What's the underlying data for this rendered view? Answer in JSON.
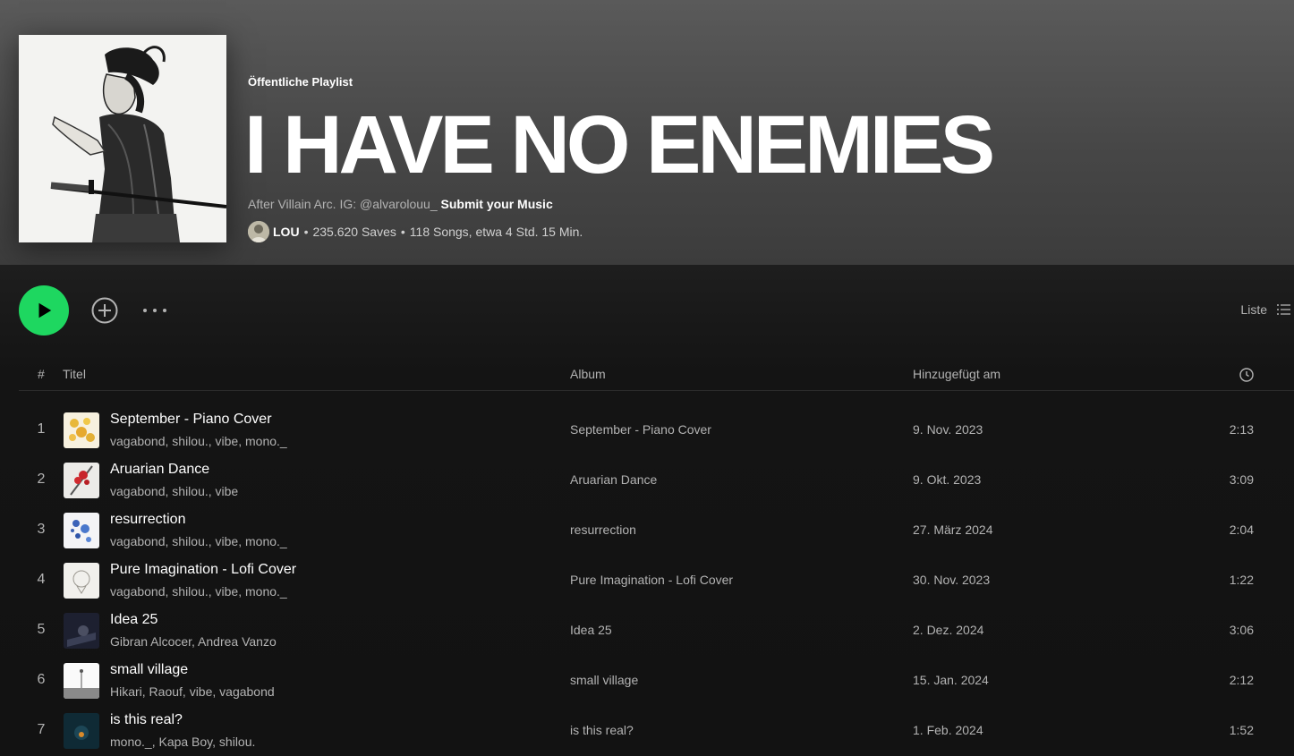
{
  "playlist": {
    "type_label": "Öffentliche Playlist",
    "title": "I HAVE NO ENEMIES",
    "description_prefix": "After Villain Arc. IG: @alvarolouu_",
    "description_link": "Submit your Music",
    "owner": "LOU",
    "saves": "235.620 Saves",
    "songs_duration": "118 Songs, etwa 4 Std. 15 Min.",
    "separator": "•"
  },
  "controls": {
    "view_label": "Liste"
  },
  "table": {
    "headers": {
      "number": "#",
      "title": "Titel",
      "album": "Album",
      "added": "Hinzugefügt am"
    },
    "rows": [
      {
        "num": "1",
        "title": "September - Piano Cover",
        "artists": "vagabond, shilou., vibe, mono._",
        "album": "September - Piano Cover",
        "added": "9. Nov. 2023",
        "duration": "2:13"
      },
      {
        "num": "2",
        "title": "Aruarian Dance",
        "artists": "vagabond, shilou., vibe",
        "album": "Aruarian Dance",
        "added": "9. Okt. 2023",
        "duration": "3:09"
      },
      {
        "num": "3",
        "title": "resurrection",
        "artists": "vagabond, shilou., vibe, mono._",
        "album": "resurrection",
        "added": "27. März 2024",
        "duration": "2:04"
      },
      {
        "num": "4",
        "title": "Pure Imagination - Lofi Cover",
        "artists": "vagabond, shilou., vibe, mono._",
        "album": "Pure Imagination - Lofi Cover",
        "added": "30. Nov. 2023",
        "duration": "1:22"
      },
      {
        "num": "5",
        "title": "Idea 25",
        "artists": "Gibran Alcocer, Andrea Vanzo",
        "album": "Idea 25",
        "added": "2. Dez. 2024",
        "duration": "3:06"
      },
      {
        "num": "6",
        "title": "small village",
        "artists": "Hikari, Raouf, vibe, vagabond",
        "album": "small village",
        "added": "15. Jan. 2024",
        "duration": "2:12"
      },
      {
        "num": "7",
        "title": "is this real?",
        "artists": "mono._, Kapa Boy, shilou.",
        "album": "is this real?",
        "added": "1. Feb. 2024",
        "duration": "1:52"
      }
    ]
  },
  "colors": {
    "accent": "#1ed760",
    "background": "#121212",
    "muted_text": "#b3b3b3"
  }
}
